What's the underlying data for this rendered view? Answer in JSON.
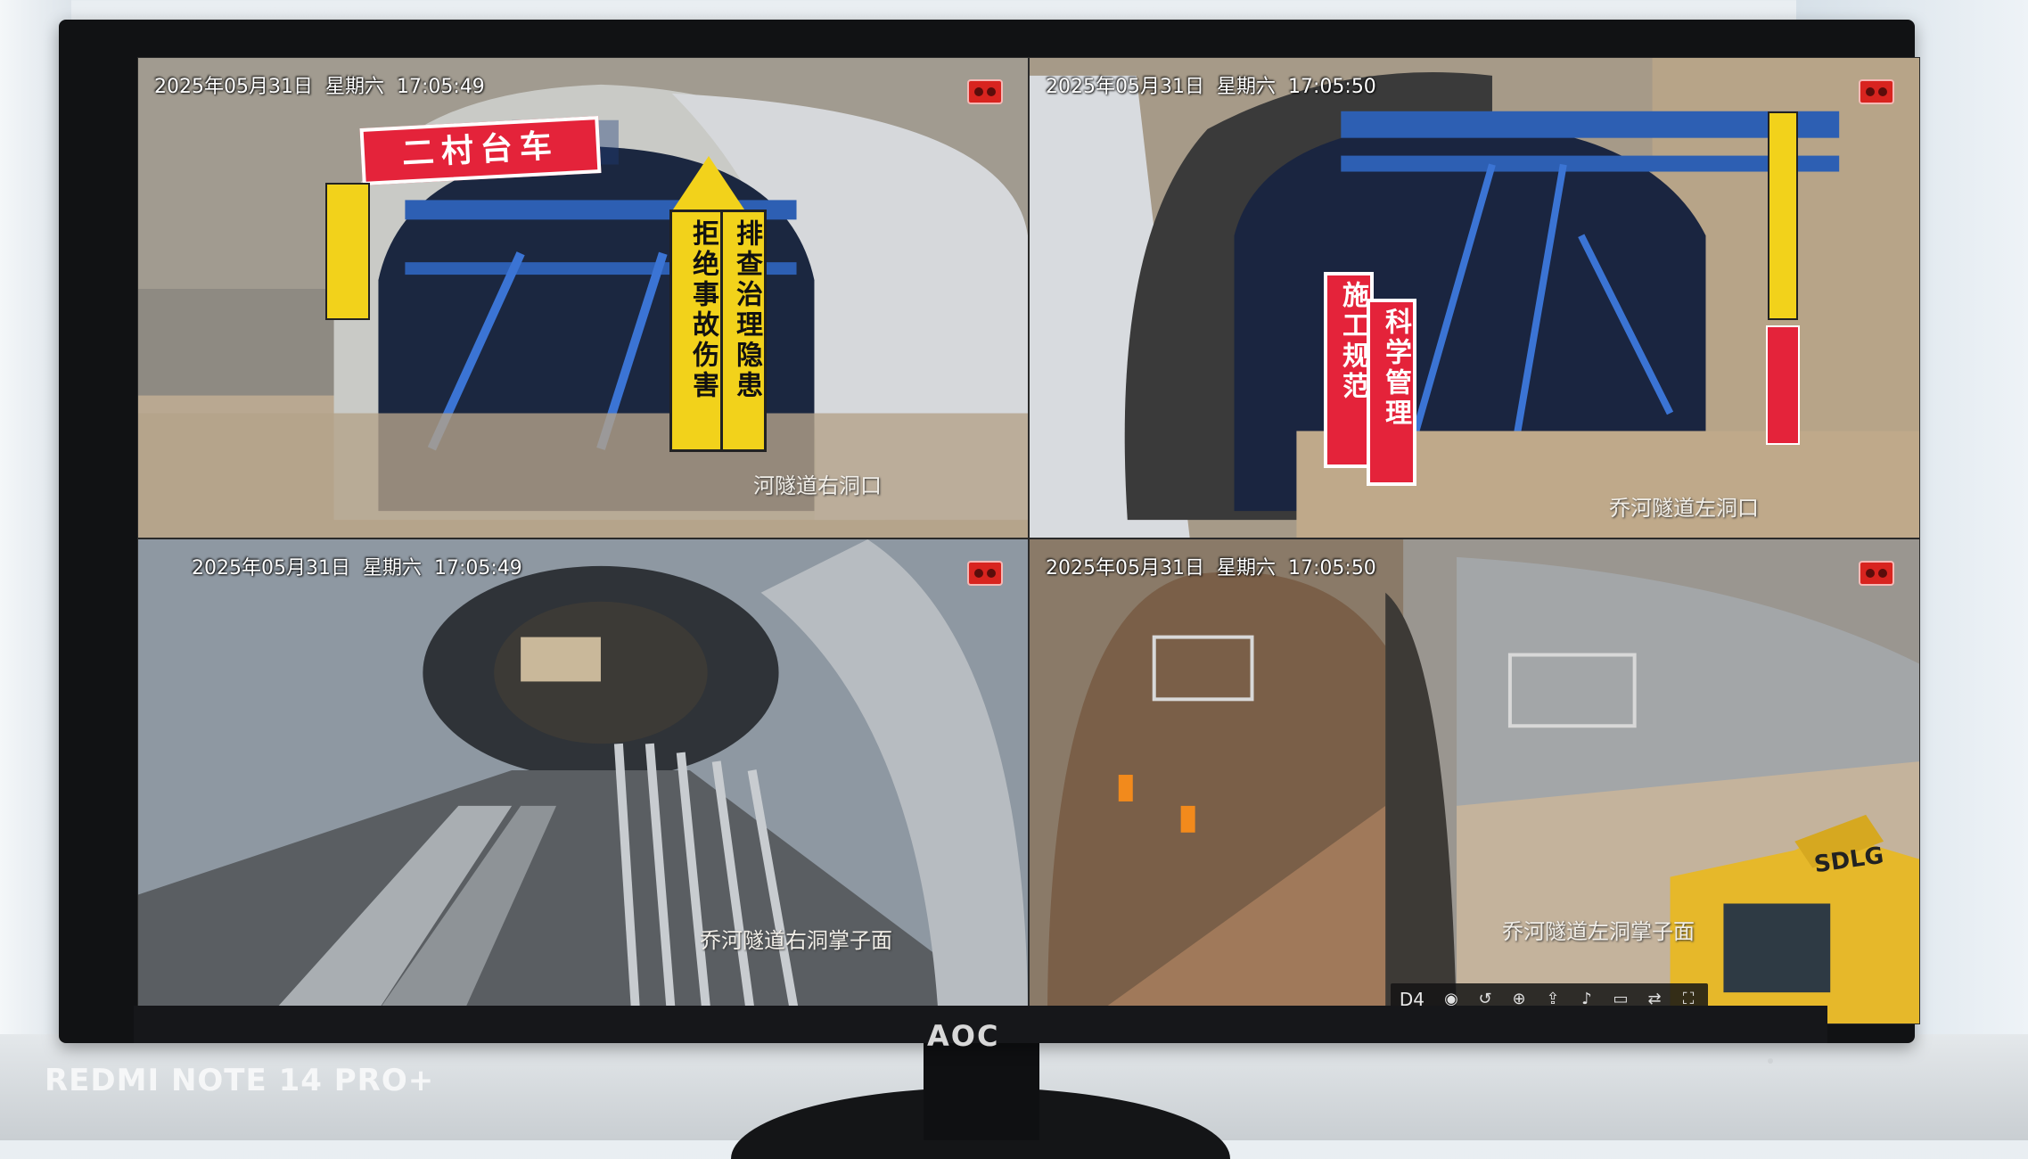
{
  "monitor": {
    "brand": "AOC"
  },
  "cameras": [
    {
      "date": "2025年05月31日",
      "weekday": "星期六",
      "time": "17:05:49",
      "name": "河隧道右洞口",
      "signs": {
        "banner": "二村台车",
        "vertical_left": "排查治理隐患",
        "vertical_right": "拒绝事故伤害"
      }
    },
    {
      "date": "2025年05月31日",
      "weekday": "星期六",
      "time": "17:05:50",
      "name": "乔河隧道左洞口",
      "signs": {
        "vertical_a": "施工规范",
        "vertical_b": "科学管理"
      }
    },
    {
      "date": "2025年05月31日",
      "weekday": "星期六",
      "time": "17:05:49",
      "name": "乔河隧道右洞掌子面"
    },
    {
      "date": "2025年05月31日",
      "weekday": "星期六",
      "time": "17:05:50",
      "name": "乔河隧道左洞掌子面",
      "machine_brand": "SDLG"
    }
  ],
  "toolbar": {
    "channel": "D4",
    "buttons": [
      "snapshot-icon",
      "replay-icon",
      "zoom-icon",
      "export-icon",
      "audio-icon",
      "screen-icon",
      "switch-icon",
      "fullscreen-icon"
    ]
  },
  "watermark": "REDMI NOTE 14 PRO+",
  "colors": {
    "warning_yellow": "#f2d21b",
    "sign_red": "#e4233a",
    "rec_red": "#d8241f"
  }
}
